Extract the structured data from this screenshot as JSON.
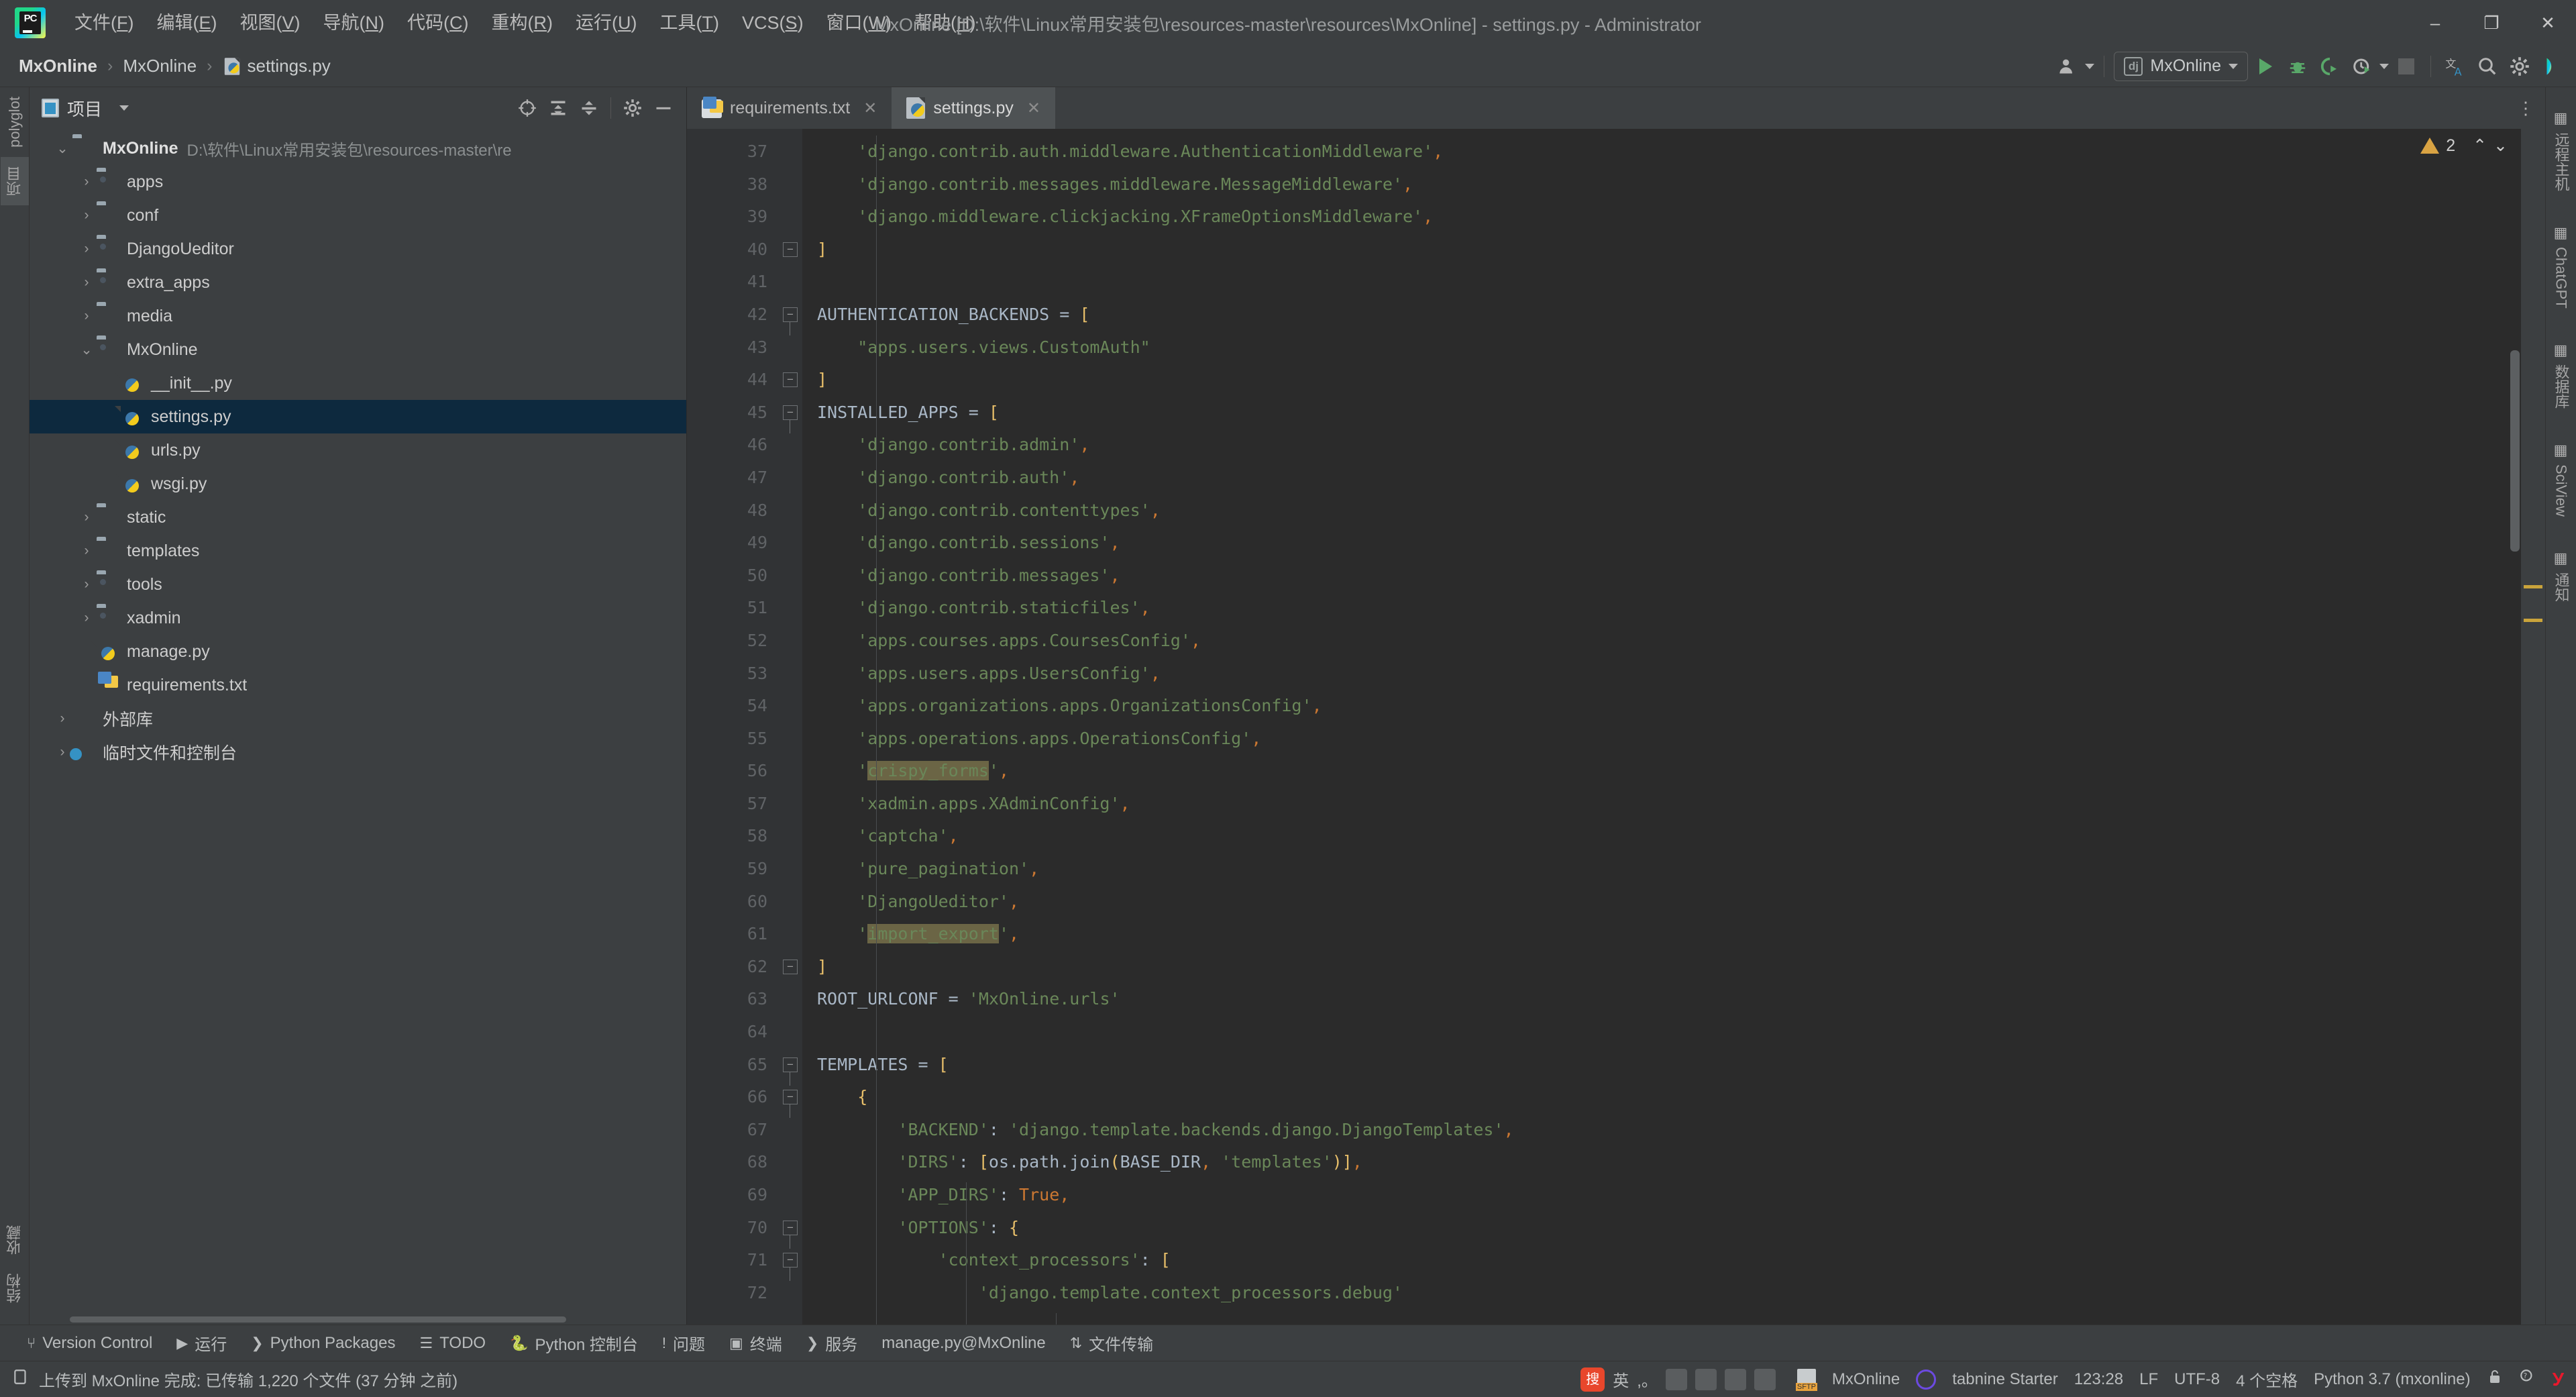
{
  "window": {
    "title": "MxOnline [D:\\软件\\Linux常用安装包\\resources-master\\resources\\MxOnline] - settings.py - Administrator",
    "minimize": "–",
    "maximize": "❐",
    "close": "✕"
  },
  "menu": {
    "items": [
      {
        "label": "文件(",
        "key": "F",
        "tail": ")"
      },
      {
        "label": "编辑(",
        "key": "E",
        "tail": ")"
      },
      {
        "label": "视图(",
        "key": "V",
        "tail": ")"
      },
      {
        "label": "导航(",
        "key": "N",
        "tail": ")"
      },
      {
        "label": "代码(",
        "key": "C",
        "tail": ")"
      },
      {
        "label": "重构(",
        "key": "R",
        "tail": ")"
      },
      {
        "label": "运行(",
        "key": "U",
        "tail": ")"
      },
      {
        "label": "工具(",
        "key": "T",
        "tail": ")"
      },
      {
        "label": "VCS(",
        "key": "S",
        "tail": ")"
      },
      {
        "label": "窗口(",
        "key": "W",
        "tail": ")"
      },
      {
        "label": "帮助(",
        "key": "H",
        "tail": ")"
      }
    ]
  },
  "breadcrumb": {
    "items": [
      "MxOnline",
      "MxOnline",
      "settings.py"
    ],
    "separator": "›"
  },
  "run_toolbar": {
    "config_name": "MxOnline",
    "config_icon_label": "dj",
    "run": "▶",
    "debug": "bug",
    "coverage": "coverage",
    "profile": "profile",
    "stop": "■"
  },
  "project_panel": {
    "title": "项目",
    "root": {
      "name": "MxOnline",
      "path": "D:\\软件\\Linux常用安装包\\resources-master\\re",
      "expanded": true
    },
    "nodes": [
      {
        "label": "apps",
        "type": "folder-src",
        "depth": 1,
        "arrow": "›"
      },
      {
        "label": "conf",
        "type": "folder",
        "depth": 1,
        "arrow": "›"
      },
      {
        "label": "DjangoUeditor",
        "type": "folder-src",
        "depth": 1,
        "arrow": "›"
      },
      {
        "label": "extra_apps",
        "type": "folder-src",
        "depth": 1,
        "arrow": "›"
      },
      {
        "label": "media",
        "type": "folder",
        "depth": 1,
        "arrow": "›"
      },
      {
        "label": "MxOnline",
        "type": "folder-src",
        "depth": 1,
        "arrow": "⌄"
      },
      {
        "label": "__init__.py",
        "type": "python",
        "depth": 2,
        "arrow": ""
      },
      {
        "label": "settings.py",
        "type": "python",
        "depth": 2,
        "arrow": "",
        "selected": true
      },
      {
        "label": "urls.py",
        "type": "python",
        "depth": 2,
        "arrow": ""
      },
      {
        "label": "wsgi.py",
        "type": "python",
        "depth": 2,
        "arrow": ""
      },
      {
        "label": "static",
        "type": "folder",
        "depth": 1,
        "arrow": "›"
      },
      {
        "label": "templates",
        "type": "folder",
        "depth": 1,
        "arrow": "›"
      },
      {
        "label": "tools",
        "type": "folder-src",
        "depth": 1,
        "arrow": "›"
      },
      {
        "label": "xadmin",
        "type": "folder-src",
        "depth": 1,
        "arrow": "›"
      },
      {
        "label": "manage.py",
        "type": "python",
        "depth": 1,
        "arrow": ""
      },
      {
        "label": "requirements.txt",
        "type": "txt",
        "depth": 1,
        "arrow": ""
      },
      {
        "label": "外部库",
        "type": "library",
        "depth": 0,
        "arrow": "›"
      },
      {
        "label": "临时文件和控制台",
        "type": "scratch",
        "depth": 0,
        "arrow": "›"
      }
    ]
  },
  "left_strip": {
    "items": [
      "polyglot",
      "项目",
      "收藏",
      "结构"
    ]
  },
  "right_strip": {
    "items": [
      "远程主机",
      "ChatGPT",
      "数据库",
      "SciView",
      "通知"
    ]
  },
  "editor": {
    "tabs": [
      {
        "label": "requirements.txt",
        "icon": "txt-file-icon",
        "active": false,
        "close": "✕"
      },
      {
        "label": "settings.py",
        "icon": "python-file-icon",
        "active": true,
        "close": "✕"
      }
    ],
    "warning_count": "2",
    "inspection_up": "⌃",
    "inspection_down": "⌄",
    "first_line_number": 37,
    "lines": [
      {
        "n": 37,
        "indent": 2,
        "fold": "",
        "tokens": [
          {
            "t": "    'django.contrib.auth.middleware.AuthenticationMiddleware'",
            "c": "s"
          },
          {
            "t": ",",
            "c": "k"
          }
        ]
      },
      {
        "n": 38,
        "indent": 2,
        "fold": "",
        "tokens": [
          {
            "t": "    'django.contrib.messages.middleware.MessageMiddleware'",
            "c": "s"
          },
          {
            "t": ",",
            "c": "k"
          }
        ]
      },
      {
        "n": 39,
        "indent": 2,
        "fold": "",
        "tokens": [
          {
            "t": "    'django.middleware.clickjacking.XFrameOptionsMiddleware'",
            "c": "s"
          },
          {
            "t": ",",
            "c": "k"
          }
        ]
      },
      {
        "n": 40,
        "indent": 0,
        "fold": "end",
        "tokens": [
          {
            "t": "]",
            "c": "br"
          }
        ]
      },
      {
        "n": 41,
        "indent": 0,
        "fold": "",
        "tokens": []
      },
      {
        "n": 42,
        "indent": 0,
        "fold": "start",
        "tokens": [
          {
            "t": "AUTHENTICATION_BACKENDS ",
            "c": "v"
          },
          {
            "t": "= ",
            "c": "v"
          },
          {
            "t": "[",
            "c": "br"
          }
        ]
      },
      {
        "n": 43,
        "indent": 0,
        "fold": "",
        "tokens": [
          {
            "t": "    \"apps.users.views.CustomAuth\"",
            "c": "s"
          }
        ]
      },
      {
        "n": 44,
        "indent": 0,
        "fold": "end",
        "tokens": [
          {
            "t": "]",
            "c": "br"
          }
        ]
      },
      {
        "n": 45,
        "indent": 0,
        "fold": "start",
        "tokens": [
          {
            "t": "INSTALLED_APPS ",
            "c": "v"
          },
          {
            "t": "= ",
            "c": "v"
          },
          {
            "t": "[",
            "c": "br"
          }
        ]
      },
      {
        "n": 46,
        "indent": 0,
        "fold": "",
        "tokens": [
          {
            "t": "    'django.contrib.admin'",
            "c": "s"
          },
          {
            "t": ",",
            "c": "k"
          }
        ]
      },
      {
        "n": 47,
        "indent": 0,
        "fold": "",
        "tokens": [
          {
            "t": "    'django.contrib.auth'",
            "c": "s"
          },
          {
            "t": ",",
            "c": "k"
          }
        ]
      },
      {
        "n": 48,
        "indent": 0,
        "fold": "",
        "tokens": [
          {
            "t": "    'django.contrib.contenttypes'",
            "c": "s"
          },
          {
            "t": ",",
            "c": "k"
          }
        ]
      },
      {
        "n": 49,
        "indent": 0,
        "fold": "",
        "tokens": [
          {
            "t": "    'django.contrib.sessions'",
            "c": "s"
          },
          {
            "t": ",",
            "c": "k"
          }
        ]
      },
      {
        "n": 50,
        "indent": 0,
        "fold": "",
        "tokens": [
          {
            "t": "    'django.contrib.messages'",
            "c": "s"
          },
          {
            "t": ",",
            "c": "k"
          }
        ]
      },
      {
        "n": 51,
        "indent": 0,
        "fold": "",
        "tokens": [
          {
            "t": "    'django.contrib.staticfiles'",
            "c": "s"
          },
          {
            "t": ",",
            "c": "k"
          }
        ]
      },
      {
        "n": 52,
        "indent": 0,
        "fold": "",
        "tokens": [
          {
            "t": "    'apps.courses.apps.CoursesConfig'",
            "c": "s"
          },
          {
            "t": ",",
            "c": "k"
          }
        ]
      },
      {
        "n": 53,
        "indent": 0,
        "fold": "",
        "tokens": [
          {
            "t": "    'apps.users.apps.UsersConfig'",
            "c": "s"
          },
          {
            "t": ",",
            "c": "k"
          }
        ]
      },
      {
        "n": 54,
        "indent": 0,
        "fold": "",
        "tokens": [
          {
            "t": "    'apps.organizations.apps.OrganizationsConfig'",
            "c": "s"
          },
          {
            "t": ",",
            "c": "k"
          }
        ]
      },
      {
        "n": 55,
        "indent": 0,
        "fold": "",
        "tokens": [
          {
            "t": "    'apps.operations.apps.OperationsConfig'",
            "c": "s"
          },
          {
            "t": ",",
            "c": "k"
          }
        ]
      },
      {
        "n": 56,
        "indent": 0,
        "fold": "",
        "tokens": [
          {
            "t": "    '",
            "c": "s"
          },
          {
            "t": "crispy_forms",
            "c": "s hl"
          },
          {
            "t": "'",
            "c": "s"
          },
          {
            "t": ",",
            "c": "k"
          }
        ]
      },
      {
        "n": 57,
        "indent": 0,
        "fold": "",
        "tokens": [
          {
            "t": "    'xadmin.apps.XAdminConfig'",
            "c": "s"
          },
          {
            "t": ",",
            "c": "k"
          }
        ]
      },
      {
        "n": 58,
        "indent": 0,
        "fold": "",
        "tokens": [
          {
            "t": "    'captcha'",
            "c": "s"
          },
          {
            "t": ",",
            "c": "k"
          }
        ]
      },
      {
        "n": 59,
        "indent": 0,
        "fold": "",
        "tokens": [
          {
            "t": "    'pure_pagination'",
            "c": "s"
          },
          {
            "t": ",",
            "c": "k"
          }
        ]
      },
      {
        "n": 60,
        "indent": 0,
        "fold": "",
        "tokens": [
          {
            "t": "    'DjangoUeditor'",
            "c": "s"
          },
          {
            "t": ",",
            "c": "k"
          }
        ]
      },
      {
        "n": 61,
        "indent": 0,
        "fold": "",
        "tokens": [
          {
            "t": "    '",
            "c": "s"
          },
          {
            "t": "import_export",
            "c": "s hl"
          },
          {
            "t": "'",
            "c": "s"
          },
          {
            "t": ",",
            "c": "k"
          }
        ]
      },
      {
        "n": 62,
        "indent": 0,
        "fold": "end",
        "tokens": [
          {
            "t": "]",
            "c": "br"
          }
        ]
      },
      {
        "n": 63,
        "indent": 0,
        "fold": "",
        "tokens": [
          {
            "t": "ROOT_URLCONF ",
            "c": "v"
          },
          {
            "t": "= ",
            "c": "v"
          },
          {
            "t": "'MxOnline.urls'",
            "c": "s"
          }
        ]
      },
      {
        "n": 64,
        "indent": 0,
        "fold": "",
        "tokens": []
      },
      {
        "n": 65,
        "indent": 0,
        "fold": "start",
        "tokens": [
          {
            "t": "TEMPLATES ",
            "c": "v"
          },
          {
            "t": "= ",
            "c": "v"
          },
          {
            "t": "[",
            "c": "br"
          }
        ]
      },
      {
        "n": 66,
        "indent": 0,
        "fold": "start",
        "tokens": [
          {
            "t": "    ",
            "c": "v"
          },
          {
            "t": "{",
            "c": "br"
          }
        ]
      },
      {
        "n": 67,
        "indent": 0,
        "fold": "",
        "tokens": [
          {
            "t": "        'BACKEND'",
            "c": "s"
          },
          {
            "t": ": ",
            "c": "v"
          },
          {
            "t": "'django.template.backends.django.DjangoTemplates'",
            "c": "s"
          },
          {
            "t": ",",
            "c": "k"
          }
        ]
      },
      {
        "n": 68,
        "indent": 0,
        "fold": "",
        "tokens": [
          {
            "t": "        'DIRS'",
            "c": "s"
          },
          {
            "t": ": ",
            "c": "v"
          },
          {
            "t": "[",
            "c": "br"
          },
          {
            "t": "os.path.join",
            "c": "v"
          },
          {
            "t": "(",
            "c": "br"
          },
          {
            "t": "BASE_DIR",
            "c": "v"
          },
          {
            "t": ", ",
            "c": "k"
          },
          {
            "t": "'templates'",
            "c": "s"
          },
          {
            "t": ")]",
            "c": "br"
          },
          {
            "t": ",",
            "c": "k"
          }
        ]
      },
      {
        "n": 69,
        "indent": 0,
        "fold": "",
        "tokens": [
          {
            "t": "        'APP_DIRS'",
            "c": "s"
          },
          {
            "t": ": ",
            "c": "v"
          },
          {
            "t": "True",
            "c": "k"
          },
          {
            "t": ",",
            "c": "k"
          }
        ]
      },
      {
        "n": 70,
        "indent": 0,
        "fold": "start",
        "tokens": [
          {
            "t": "        'OPTIONS'",
            "c": "s"
          },
          {
            "t": ": ",
            "c": "v"
          },
          {
            "t": "{",
            "c": "br"
          }
        ]
      },
      {
        "n": 71,
        "indent": 0,
        "fold": "start",
        "tokens": [
          {
            "t": "            'context_processors'",
            "c": "s"
          },
          {
            "t": ": ",
            "c": "v"
          },
          {
            "t": "[",
            "c": "br"
          }
        ]
      },
      {
        "n": 72,
        "indent": 0,
        "fold": "",
        "tokens": [
          {
            "t": "                'django.template.context_processors.debug'",
            "c": "s"
          }
        ]
      }
    ]
  },
  "bottom_toolbar": {
    "items": [
      {
        "label": "Version Control",
        "icon": "branch-icon"
      },
      {
        "label": "运行",
        "icon": "run-icon"
      },
      {
        "label": "Python Packages",
        "icon": "packages-icon"
      },
      {
        "label": "TODO",
        "icon": "todo-icon"
      },
      {
        "label": "Python 控制台",
        "icon": "python-console-icon"
      },
      {
        "label": "问题",
        "icon": "problems-icon"
      },
      {
        "label": "终端",
        "icon": "terminal-icon"
      },
      {
        "label": "服务",
        "icon": "services-icon"
      },
      {
        "label": "manage.py@MxOnline",
        "icon": ""
      },
      {
        "label": "文件传输",
        "icon": "file-transfer-icon"
      }
    ]
  },
  "status_bar": {
    "message": "上传到 MxOnline 完成: 已传输 1,220 个文件 (37 分钟 之前)",
    "sftp_target": "MxOnline",
    "tabnine": "tabnine Starter",
    "caret": "123:28",
    "line_sep": "LF",
    "encoding": "UTF-8",
    "indent": "4 个空格",
    "interpreter": "Python 3.7 (mxonline)",
    "ime_lang": "英"
  },
  "colors": {
    "accent_blue": "#3592c4",
    "selection": "#0d293e",
    "string_green": "#6a8759",
    "keyword_orange": "#cc7832",
    "bracket_yellow": "#e8bf6a",
    "highlight_olive": "#6b6545",
    "warning_yellow": "#d9a343",
    "bg_editor": "#2b2b2b",
    "bg_panel": "#3c3f41"
  }
}
